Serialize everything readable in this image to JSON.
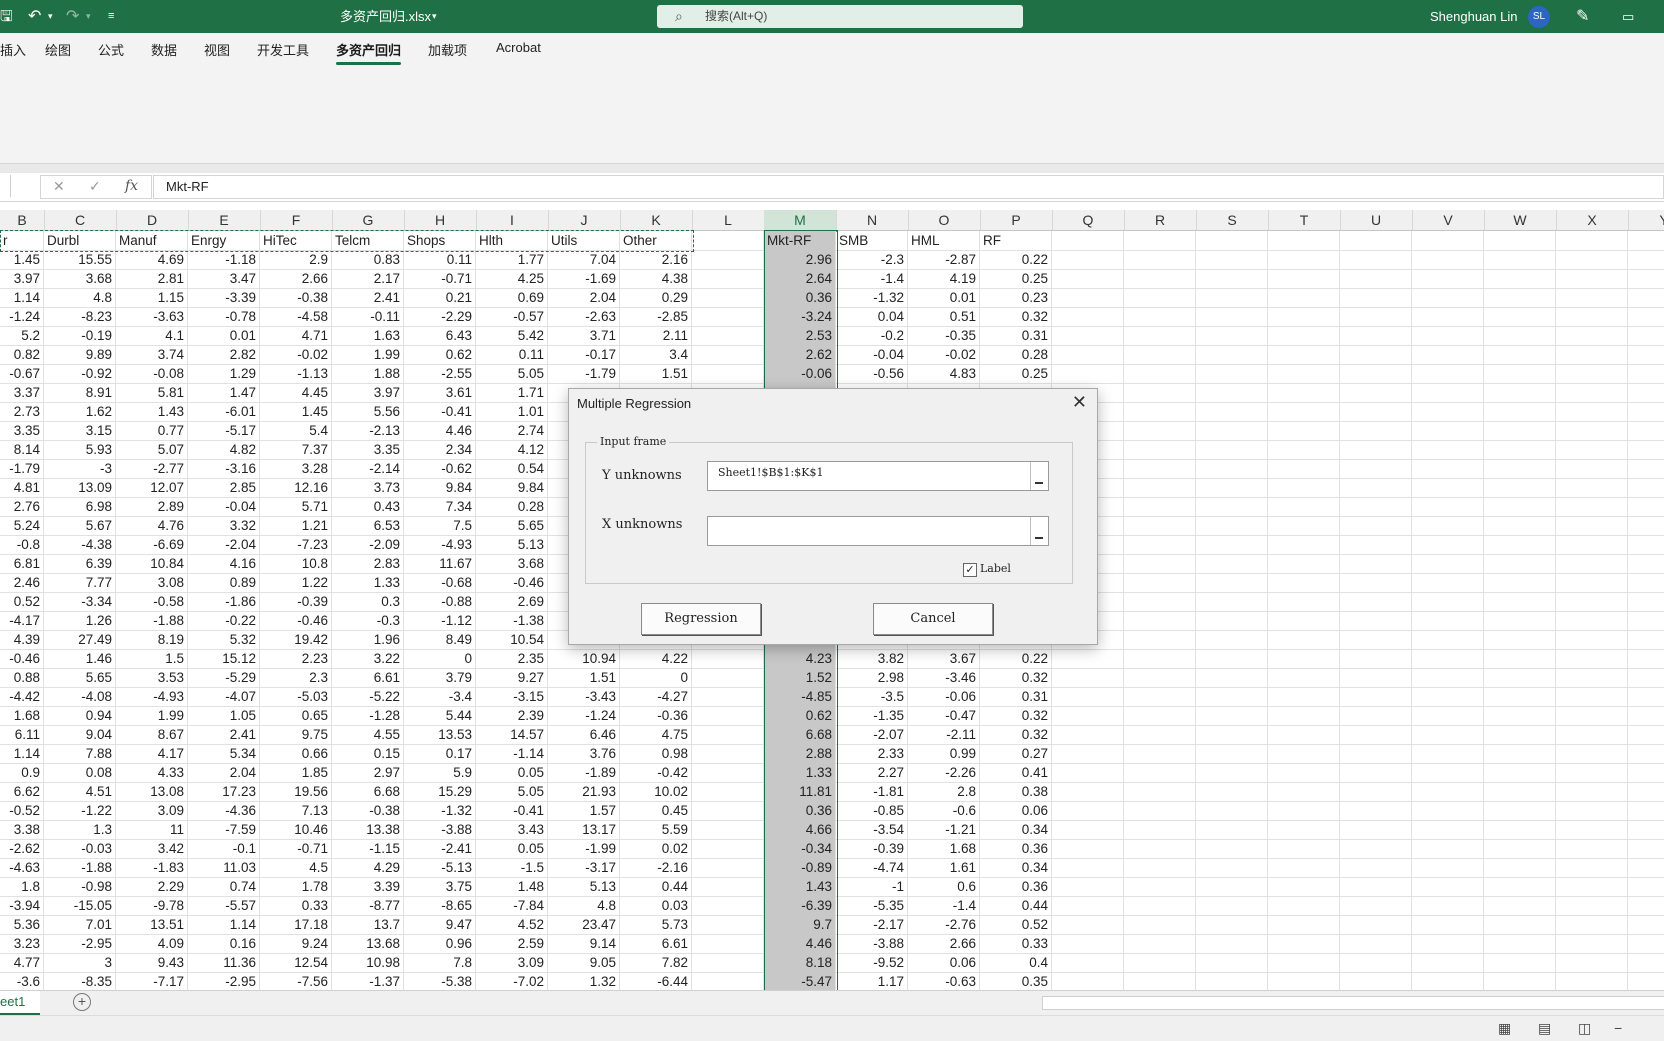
{
  "titlebar": {
    "filename": "多资产回归.xlsx",
    "search_placeholder": "搜索(Alt+Q)",
    "user_name": "Shenghuan Lin",
    "avatar_initials": "SL"
  },
  "ribbon_tabs": [
    "插入",
    "绘图",
    "公式",
    "数据",
    "视图",
    "开发工具",
    "多资产回归",
    "加载项",
    "Acrobat"
  ],
  "ribbon_active_tab": "多资产回归",
  "formula_bar": {
    "content": "Mkt-RF"
  },
  "columns": [
    "B",
    "C",
    "D",
    "E",
    "F",
    "G",
    "H",
    "I",
    "J",
    "K",
    "L",
    "M",
    "N",
    "O",
    "P",
    "Q",
    "R",
    "S",
    "T",
    "U",
    "V",
    "W",
    "X",
    "Y"
  ],
  "selected_column": "M",
  "left_headers": [
    "r",
    "Durbl",
    "Manuf",
    "Enrgy",
    "HiTec",
    "Telcm",
    "Shops",
    "Hlth",
    "Utils",
    "Other"
  ],
  "right_headers": [
    "Mkt-RF",
    "SMB",
    "HML",
    "RF"
  ],
  "left_rows": [
    [
      "1.45",
      "15.55",
      "4.69",
      "-1.18",
      "2.9",
      "0.83",
      "0.11",
      "1.77",
      "7.04",
      "2.16"
    ],
    [
      "3.97",
      "3.68",
      "2.81",
      "3.47",
      "2.66",
      "2.17",
      "-0.71",
      "4.25",
      "-1.69",
      "4.38"
    ],
    [
      "1.14",
      "4.8",
      "1.15",
      "-3.39",
      "-0.38",
      "2.41",
      "0.21",
      "0.69",
      "2.04",
      "0.29"
    ],
    [
      "-1.24",
      "-8.23",
      "-3.63",
      "-0.78",
      "-4.58",
      "-0.11",
      "-2.29",
      "-0.57",
      "-2.63",
      "-2.85"
    ],
    [
      "5.2",
      "-0.19",
      "4.1",
      "0.01",
      "4.71",
      "1.63",
      "6.43",
      "5.42",
      "3.71",
      "2.11"
    ],
    [
      "0.82",
      "9.89",
      "3.74",
      "2.82",
      "-0.02",
      "1.99",
      "0.62",
      "0.11",
      "-0.17",
      "3.4"
    ],
    [
      "-0.67",
      "-0.92",
      "-0.08",
      "1.29",
      "-1.13",
      "1.88",
      "-2.55",
      "5.05",
      "-1.79",
      "1.51"
    ],
    [
      "3.37",
      "8.91",
      "5.81",
      "1.47",
      "4.45",
      "3.97",
      "3.61",
      "1.71",
      "",
      ""
    ],
    [
      "2.73",
      "1.62",
      "1.43",
      "-6.01",
      "1.45",
      "5.56",
      "-0.41",
      "1.01",
      "",
      ""
    ],
    [
      "3.35",
      "3.15",
      "0.77",
      "-5.17",
      "5.4",
      "-2.13",
      "4.46",
      "2.74",
      "",
      ""
    ],
    [
      "8.14",
      "5.93",
      "5.07",
      "4.82",
      "7.37",
      "3.35",
      "2.34",
      "4.12",
      "",
      ""
    ],
    [
      "-1.79",
      "-3",
      "-2.77",
      "-3.16",
      "3.28",
      "-2.14",
      "-0.62",
      "0.54",
      "",
      ""
    ],
    [
      "4.81",
      "13.09",
      "12.07",
      "2.85",
      "12.16",
      "3.73",
      "9.84",
      "9.84",
      "",
      ""
    ],
    [
      "2.76",
      "6.98",
      "2.89",
      "-0.04",
      "5.71",
      "0.43",
      "7.34",
      "0.28",
      "",
      ""
    ],
    [
      "5.24",
      "5.67",
      "4.76",
      "3.32",
      "1.21",
      "6.53",
      "7.5",
      "5.65",
      "",
      ""
    ],
    [
      "-0.8",
      "-4.38",
      "-6.69",
      "-2.04",
      "-7.23",
      "-2.09",
      "-4.93",
      "5.13",
      "",
      ""
    ],
    [
      "6.81",
      "6.39",
      "10.84",
      "4.16",
      "10.8",
      "2.83",
      "11.67",
      "3.68",
      "",
      ""
    ],
    [
      "2.46",
      "7.77",
      "3.08",
      "0.89",
      "1.22",
      "1.33",
      "-0.68",
      "-0.46",
      "",
      ""
    ],
    [
      "0.52",
      "-3.34",
      "-0.58",
      "-1.86",
      "-0.39",
      "0.3",
      "-0.88",
      "2.69",
      "",
      ""
    ],
    [
      "-4.17",
      "1.26",
      "-1.88",
      "-0.22",
      "-0.46",
      "-0.3",
      "-1.12",
      "-1.38",
      "",
      ""
    ],
    [
      "4.39",
      "27.49",
      "8.19",
      "5.32",
      "19.42",
      "1.96",
      "8.49",
      "10.54",
      "",
      ""
    ],
    [
      "-0.46",
      "1.46",
      "1.5",
      "15.12",
      "2.23",
      "3.22",
      "0",
      "2.35",
      "10.94",
      "4.22"
    ],
    [
      "0.88",
      "5.65",
      "3.53",
      "-5.29",
      "2.3",
      "6.61",
      "3.79",
      "9.27",
      "1.51",
      "0"
    ],
    [
      "-4.42",
      "-4.08",
      "-4.93",
      "-4.07",
      "-5.03",
      "-5.22",
      "-3.4",
      "-3.15",
      "-3.43",
      "-4.27"
    ],
    [
      "1.68",
      "0.94",
      "1.99",
      "1.05",
      "0.65",
      "-1.28",
      "5.44",
      "2.39",
      "-1.24",
      "-0.36"
    ],
    [
      "6.11",
      "9.04",
      "8.67",
      "2.41",
      "9.75",
      "4.55",
      "13.53",
      "14.57",
      "6.46",
      "4.75"
    ],
    [
      "1.14",
      "7.88",
      "4.17",
      "5.34",
      "0.66",
      "0.15",
      "0.17",
      "-1.14",
      "3.76",
      "0.98"
    ],
    [
      "0.9",
      "0.08",
      "4.33",
      "2.04",
      "1.85",
      "2.97",
      "5.9",
      "0.05",
      "-1.89",
      "-0.42"
    ],
    [
      "6.62",
      "4.51",
      "13.08",
      "17.23",
      "19.56",
      "6.68",
      "15.29",
      "5.05",
      "21.93",
      "10.02"
    ],
    [
      "-0.52",
      "-1.22",
      "3.09",
      "-4.36",
      "7.13",
      "-0.38",
      "-1.32",
      "-0.41",
      "1.57",
      "0.45"
    ],
    [
      "3.38",
      "1.3",
      "11",
      "-7.59",
      "10.46",
      "13.38",
      "-3.88",
      "3.43",
      "13.17",
      "5.59"
    ],
    [
      "-2.62",
      "-0.03",
      "3.42",
      "-0.1",
      "-0.71",
      "-1.15",
      "-2.41",
      "0.05",
      "-1.99",
      "0.02"
    ],
    [
      "-4.63",
      "-1.88",
      "-1.83",
      "11.03",
      "4.5",
      "4.29",
      "-5.13",
      "-1.5",
      "-3.17",
      "-2.16"
    ],
    [
      "1.8",
      "-0.98",
      "2.29",
      "0.74",
      "1.78",
      "3.39",
      "3.75",
      "1.48",
      "5.13",
      "0.44"
    ],
    [
      "-3.94",
      "-15.05",
      "-9.78",
      "-5.57",
      "0.33",
      "-8.77",
      "-8.65",
      "-7.84",
      "4.8",
      "0.03"
    ],
    [
      "5.36",
      "7.01",
      "13.51",
      "1.14",
      "17.18",
      "13.7",
      "9.47",
      "4.52",
      "23.47",
      "5.73"
    ],
    [
      "3.23",
      "-2.95",
      "4.09",
      "0.16",
      "9.24",
      "13.68",
      "0.96",
      "2.59",
      "9.14",
      "6.61"
    ],
    [
      "4.77",
      "3",
      "9.43",
      "11.36",
      "12.54",
      "10.98",
      "7.8",
      "3.09",
      "9.05",
      "7.82"
    ],
    [
      "-3.6",
      "-8.35",
      "-7.17",
      "-2.95",
      "-7.56",
      "-1.37",
      "-5.38",
      "-7.02",
      "1.32",
      "-6.44"
    ]
  ],
  "right_rows": [
    [
      "2.96",
      "-2.3",
      "-2.87",
      "0.22"
    ],
    [
      "2.64",
      "-1.4",
      "4.19",
      "0.25"
    ],
    [
      "0.36",
      "-1.32",
      "0.01",
      "0.23"
    ],
    [
      "-3.24",
      "0.04",
      "0.51",
      "0.32"
    ],
    [
      "2.53",
      "-0.2",
      "-0.35",
      "0.31"
    ],
    [
      "2.62",
      "-0.04",
      "-0.02",
      "0.28"
    ],
    [
      "-0.06",
      "-0.56",
      "4.83",
      "0.25"
    ],
    [
      "",
      "",
      "",
      ""
    ],
    [
      "",
      "",
      "",
      ""
    ],
    [
      "",
      "",
      "",
      ""
    ],
    [
      "",
      "",
      "",
      ""
    ],
    [
      "",
      "",
      "",
      ""
    ],
    [
      "",
      "",
      "",
      ""
    ],
    [
      "",
      "",
      "",
      ""
    ],
    [
      "",
      "",
      "",
      ""
    ],
    [
      "",
      "",
      "",
      ""
    ],
    [
      "",
      "",
      "",
      ""
    ],
    [
      "",
      "",
      "",
      ""
    ],
    [
      "",
      "",
      "",
      ""
    ],
    [
      "",
      "",
      "",
      ""
    ],
    [
      "",
      "",
      "",
      ""
    ],
    [
      "4.23",
      "3.82",
      "3.67",
      "0.22"
    ],
    [
      "1.52",
      "2.98",
      "-3.46",
      "0.32"
    ],
    [
      "-4.85",
      "-3.5",
      "-0.06",
      "0.31"
    ],
    [
      "0.62",
      "-1.35",
      "-0.47",
      "0.32"
    ],
    [
      "6.68",
      "-2.07",
      "-2.11",
      "0.32"
    ],
    [
      "2.88",
      "2.33",
      "0.99",
      "0.27"
    ],
    [
      "1.33",
      "2.27",
      "-2.26",
      "0.41"
    ],
    [
      "11.81",
      "-1.81",
      "2.8",
      "0.38"
    ],
    [
      "0.36",
      "-0.85",
      "-0.6",
      "0.06"
    ],
    [
      "4.66",
      "-3.54",
      "-1.21",
      "0.34"
    ],
    [
      "-0.34",
      "-0.39",
      "1.68",
      "0.36"
    ],
    [
      "-0.89",
      "-4.74",
      "1.61",
      "0.34"
    ],
    [
      "1.43",
      "-1",
      "0.6",
      "0.36"
    ],
    [
      "-6.39",
      "-5.35",
      "-1.4",
      "0.44"
    ],
    [
      "9.7",
      "-2.17",
      "-2.76",
      "0.52"
    ],
    [
      "4.46",
      "-3.88",
      "2.66",
      "0.33"
    ],
    [
      "8.18",
      "-9.52",
      "0.06",
      "0.4"
    ],
    [
      "-5.47",
      "1.17",
      "-0.63",
      "0.35"
    ]
  ],
  "dialog": {
    "title": "Multiple Regression",
    "frame_label": "Input frame",
    "y_label": "Y unknowns",
    "y_value": "Sheet1!$B$1:$K$1",
    "x_label": "X unknowns",
    "x_value": "",
    "checkbox_label": "Label",
    "checkbox_checked": true,
    "regression_button": "Regression",
    "cancel_button": "Cancel"
  },
  "sheet_tab": "eet1",
  "colors": {
    "excel_green": "#1f7145",
    "selection_gray": "#c8c8c8"
  }
}
